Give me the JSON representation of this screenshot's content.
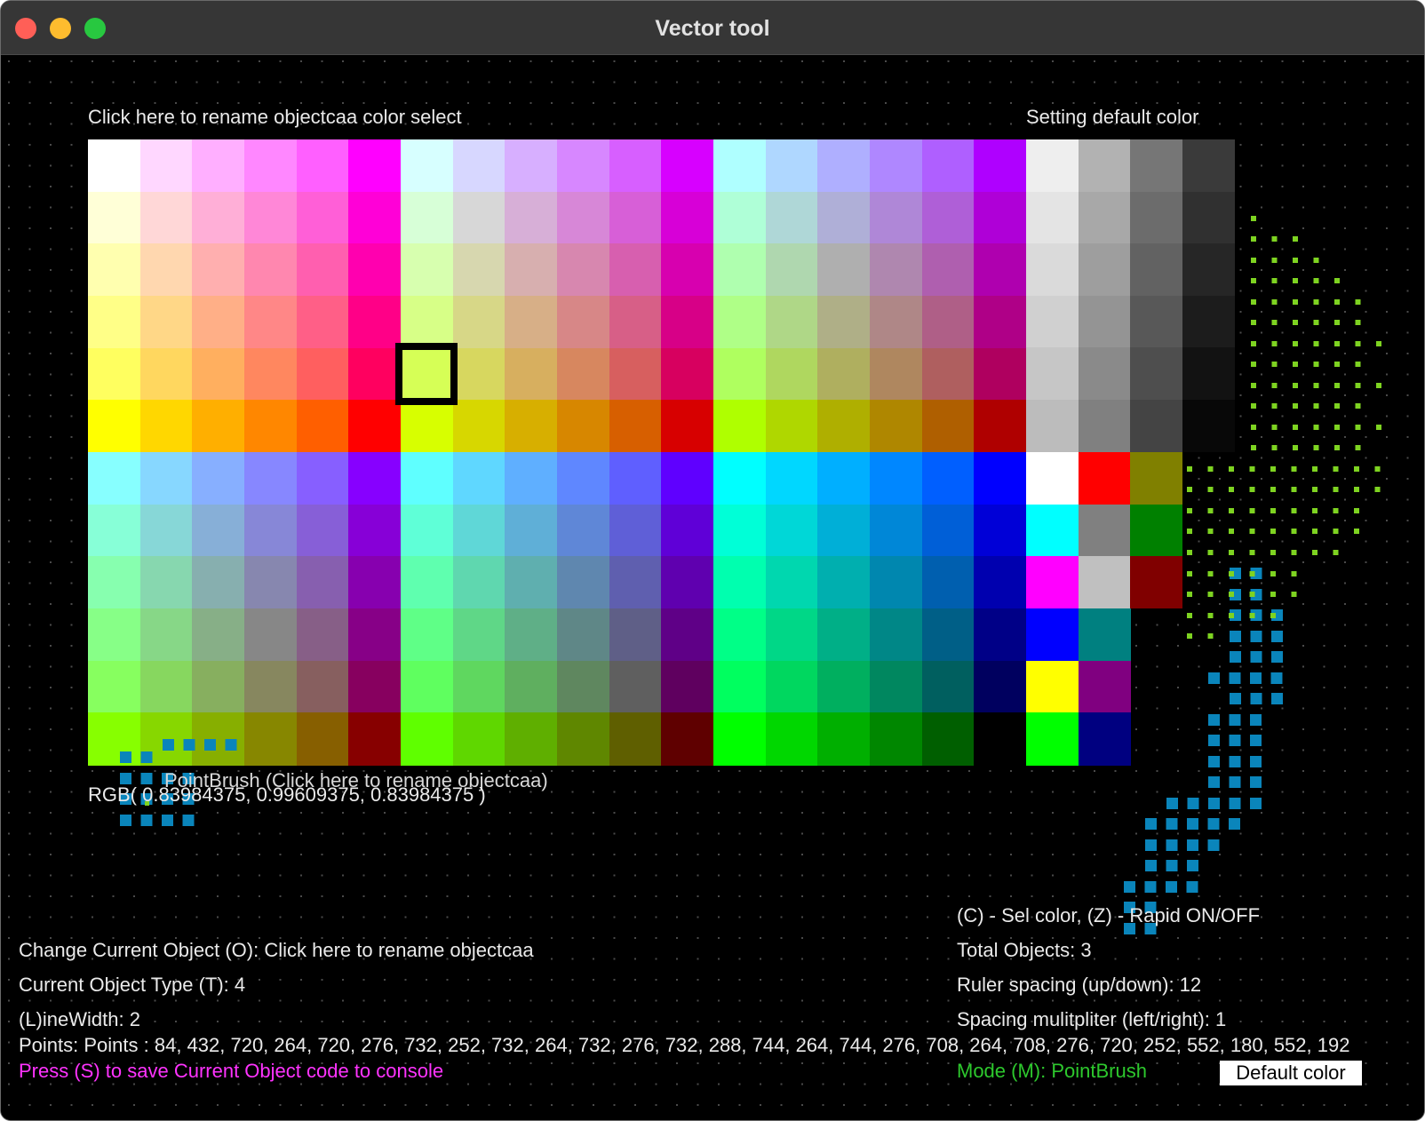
{
  "window": {
    "title": "Vector tool",
    "buttons": [
      "close",
      "minimize",
      "maximize"
    ],
    "button_colors": {
      "close": "#ff5f57",
      "minimize": "#febc2e",
      "maximize": "#28c840"
    }
  },
  "canvas": {
    "background": "#000000",
    "grid_dot_color": "#4a4a4a"
  },
  "header": {
    "color_select_label": "Click  here  to  rename  objectcaa color select",
    "default_color_label": "Setting default color"
  },
  "palette": {
    "selected_color": "#d6ff56",
    "colors": [
      [
        "#ffffff",
        "#ffd7ff",
        "#ffafff",
        "#ff87ff",
        "#ff5fff",
        "#ff00ff",
        "#d7ffff",
        "#d7d7ff",
        "#d7afff",
        "#d787ff",
        "#d75fff",
        "#d700ff",
        "#afffff",
        "#afd7ff",
        "#afafff",
        "#af87ff",
        "#af5fff",
        "#af00ff"
      ],
      [
        "#ffffd7",
        "#ffd7d7",
        "#ffafd7",
        "#ff87d7",
        "#ff5fd7",
        "#ff00d7",
        "#d7ffd7",
        "#d7d7d7",
        "#d7afd7",
        "#d787d7",
        "#d75fd7",
        "#d700d7",
        "#afffd7",
        "#afd7d7",
        "#afafd7",
        "#af87d7",
        "#af5fd7",
        "#af00d7"
      ],
      [
        "#ffffaf",
        "#ffd7af",
        "#ffafaf",
        "#ff87af",
        "#ff5faf",
        "#ff00af",
        "#d7ffaf",
        "#d7d7af",
        "#d7afaf",
        "#d787af",
        "#d75faf",
        "#d700af",
        "#afffaf",
        "#afd7af",
        "#afafaf",
        "#af87af",
        "#af5faf",
        "#af00af"
      ],
      [
        "#ffff87",
        "#ffd787",
        "#ffaf87",
        "#ff8787",
        "#ff5f87",
        "#ff0087",
        "#d7ff87",
        "#d7d787",
        "#d7af87",
        "#d78787",
        "#d75f87",
        "#d70087",
        "#afff87",
        "#afd787",
        "#afaf87",
        "#af8787",
        "#af5f87",
        "#af0087"
      ],
      [
        "#ffff5f",
        "#ffd75f",
        "#ffaf5f",
        "#ff875f",
        "#ff5f5f",
        "#ff005f",
        "#d7ff5f",
        "#d7d75f",
        "#d7af5f",
        "#d7875f",
        "#d75f5f",
        "#d7005f",
        "#afff5f",
        "#afd75f",
        "#afaf5f",
        "#af875f",
        "#af5f5f",
        "#af005f"
      ],
      [
        "#ffff00",
        "#ffd700",
        "#ffaf00",
        "#ff8700",
        "#ff5f00",
        "#ff0000",
        "#d7ff00",
        "#d7d700",
        "#d7af00",
        "#d78700",
        "#d75f00",
        "#d70000",
        "#afff00",
        "#afd700",
        "#afaf00",
        "#af8700",
        "#af5f00",
        "#af0000"
      ],
      [
        "#87ffff",
        "#87d7ff",
        "#87afff",
        "#8787ff",
        "#875fff",
        "#8700ff",
        "#5fffff",
        "#5fd7ff",
        "#5fafff",
        "#5f87ff",
        "#5f5fff",
        "#5f00ff",
        "#00ffff",
        "#00d7ff",
        "#00afff",
        "#0087ff",
        "#005fff",
        "#0000ff"
      ],
      [
        "#87ffd7",
        "#87d7d7",
        "#87afd7",
        "#8787d7",
        "#875fd7",
        "#8700d7",
        "#5fffd7",
        "#5fd7d7",
        "#5fafd7",
        "#5f87d7",
        "#5f5fd7",
        "#5f00d7",
        "#00ffd7",
        "#00d7d7",
        "#00afd7",
        "#0087d7",
        "#005fd7",
        "#0000d7"
      ],
      [
        "#87ffaf",
        "#87d7af",
        "#87afaf",
        "#8787af",
        "#875faf",
        "#8700af",
        "#5fffaf",
        "#5fd7af",
        "#5fafaf",
        "#5f87af",
        "#5f5faf",
        "#5f00af",
        "#00ffaf",
        "#00d7af",
        "#00afaf",
        "#0087af",
        "#005faf",
        "#0000af"
      ],
      [
        "#87ff87",
        "#87d787",
        "#87af87",
        "#878787",
        "#875f87",
        "#870087",
        "#5fff87",
        "#5fd787",
        "#5faf87",
        "#5f8787",
        "#5f5f87",
        "#5f0087",
        "#00ff87",
        "#00d787",
        "#00af87",
        "#008787",
        "#005f87",
        "#000087"
      ],
      [
        "#87ff5f",
        "#87d75f",
        "#87af5f",
        "#87875f",
        "#875f5f",
        "#87005f",
        "#5fff5f",
        "#5fd75f",
        "#5faf5f",
        "#5f875f",
        "#5f5f5f",
        "#5f005f",
        "#00ff5f",
        "#00d75f",
        "#00af5f",
        "#00875f",
        "#005f5f",
        "#00005f"
      ],
      [
        "#87ff00",
        "#87d700",
        "#87af00",
        "#878700",
        "#875f00",
        "#870000",
        "#5fff00",
        "#5fd700",
        "#5faf00",
        "#5f8700",
        "#5f5f00",
        "#5f0000",
        "#00ff00",
        "#00d700",
        "#00af00",
        "#008700",
        "#005f00",
        "#000000"
      ]
    ],
    "grays": [
      [
        "#eeeeee",
        "#b2b2b2",
        "#767676",
        "#3a3a3a"
      ],
      [
        "#e4e4e4",
        "#a8a8a8",
        "#6c6c6c",
        "#303030"
      ],
      [
        "#dadada",
        "#9e9e9e",
        "#626262",
        "#262626"
      ],
      [
        "#d0d0d0",
        "#949494",
        "#585858",
        "#1c1c1c"
      ],
      [
        "#c6c6c6",
        "#8a8a8a",
        "#4e4e4e",
        "#121212"
      ],
      [
        "#bcbcbc",
        "#808080",
        "#444444",
        "#080808"
      ]
    ],
    "base_colors": [
      [
        "#ffffff",
        "#ff0000",
        "#808000"
      ],
      [
        "#00ffff",
        "#808080",
        "#008000"
      ],
      [
        "#ff00ff",
        "#c0c0c0",
        "#800000"
      ],
      [
        "#0000ff",
        "#008080",
        ""
      ],
      [
        "#ffff00",
        "#800080",
        ""
      ],
      [
        "#00ff00",
        "#000080",
        ""
      ]
    ]
  },
  "overlay": {
    "brush_label": "PointBrush (Click  here  to  rename  objectcaa)",
    "rgb_text": "RGB( 0.83984375, 0.99609375, 0.83984375 )",
    "blue_square_color": "#0a85bb",
    "green_dot_color": "#7ed321"
  },
  "info": {
    "change_object": "Change Current Object (O): Click  here  to  rename  objectcaa",
    "object_type": "Current Object Type (T): 4",
    "line_width": "(L)ineWidth: 2",
    "points": "Points: Points : 84, 432, 720, 264, 720, 276, 732, 252, 732, 264, 732, 276, 732, 288, 744, 264, 744, 276, 708, 264, 708, 276, 720, 252, 552, 180, 552, 192",
    "save_hint": "Press (S) to save Current Object code to console",
    "save_hint_color": "#ff33ff",
    "sel_color_hint": "(C) - Sel color, (Z) - Rapid ON/OFF",
    "total_objects": "Total Objects: 3",
    "ruler_spacing": "Ruler spacing (up/down): 12",
    "spacing_multiplier": "Spacing mulitpliter (left/right): 1",
    "mode": "Mode (M): PointBrush",
    "mode_color": "#2dc82d",
    "default_color_button": "Default color"
  }
}
